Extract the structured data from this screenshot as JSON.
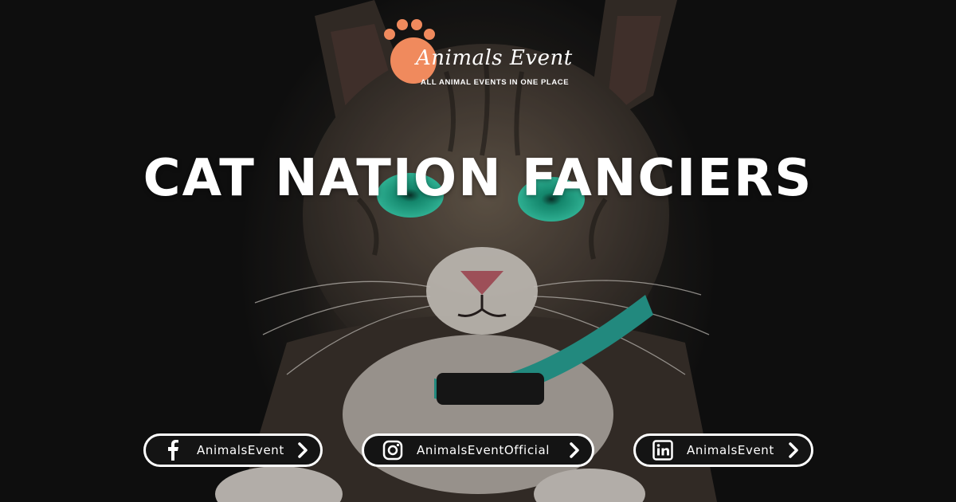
{
  "brand": {
    "name": "Animals Event",
    "tagline": "ALL ANIMAL EVENTS IN ONE PLACE",
    "accent": "#f08a5d"
  },
  "headline": "CAT NATION FANCIERS",
  "social": [
    {
      "network": "facebook",
      "icon": "facebook-icon",
      "handle": "AnimalsEvent"
    },
    {
      "network": "instagram",
      "icon": "instagram-icon",
      "handle": "AnimalsEventOfficial"
    },
    {
      "network": "linkedin",
      "icon": "linkedin-icon",
      "handle": "AnimalsEvent"
    }
  ],
  "colors": {
    "text": "#ffffff",
    "pill_bg": "#141414",
    "eye": "#2fc7a6",
    "collar": "#2aa89a"
  }
}
